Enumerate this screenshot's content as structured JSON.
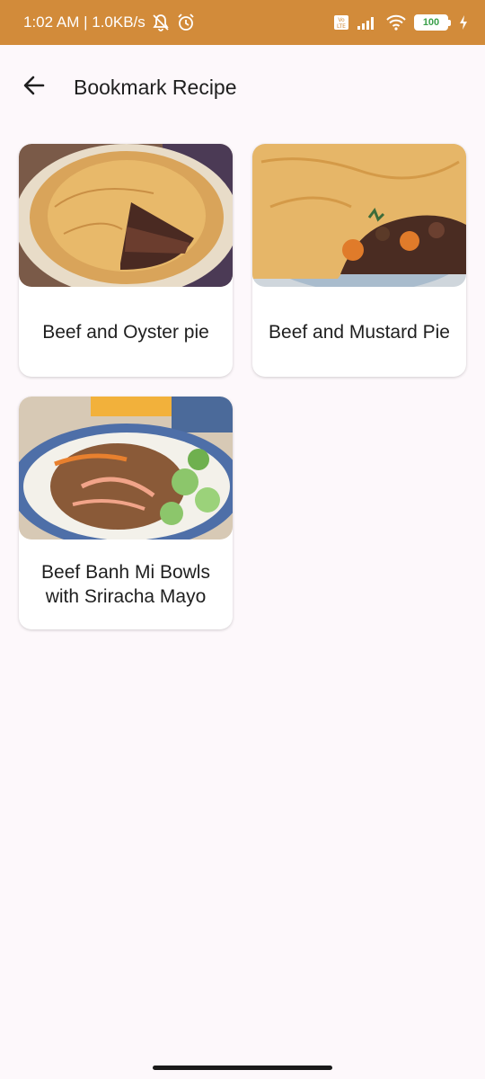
{
  "status_bar": {
    "time_speed": "1:02 AM | 1.0KB/s",
    "battery": "100",
    "icons": [
      "mute-icon",
      "alarm-icon",
      "volte-icon",
      "signal-icon",
      "wifi-icon",
      "battery-icon",
      "charging-icon"
    ]
  },
  "app_bar": {
    "title": "Bookmark Recipe",
    "back_icon": "arrow-back-icon"
  },
  "recipes": [
    {
      "title": "Beef and Oyster pie"
    },
    {
      "title": "Beef and Mustard Pie"
    },
    {
      "title": "Beef Banh Mi Bowls with Sriracha Mayo"
    }
  ],
  "colors": {
    "status_bar": "#d28b3a",
    "background": "#fdf8fb",
    "card": "#ffffff"
  }
}
